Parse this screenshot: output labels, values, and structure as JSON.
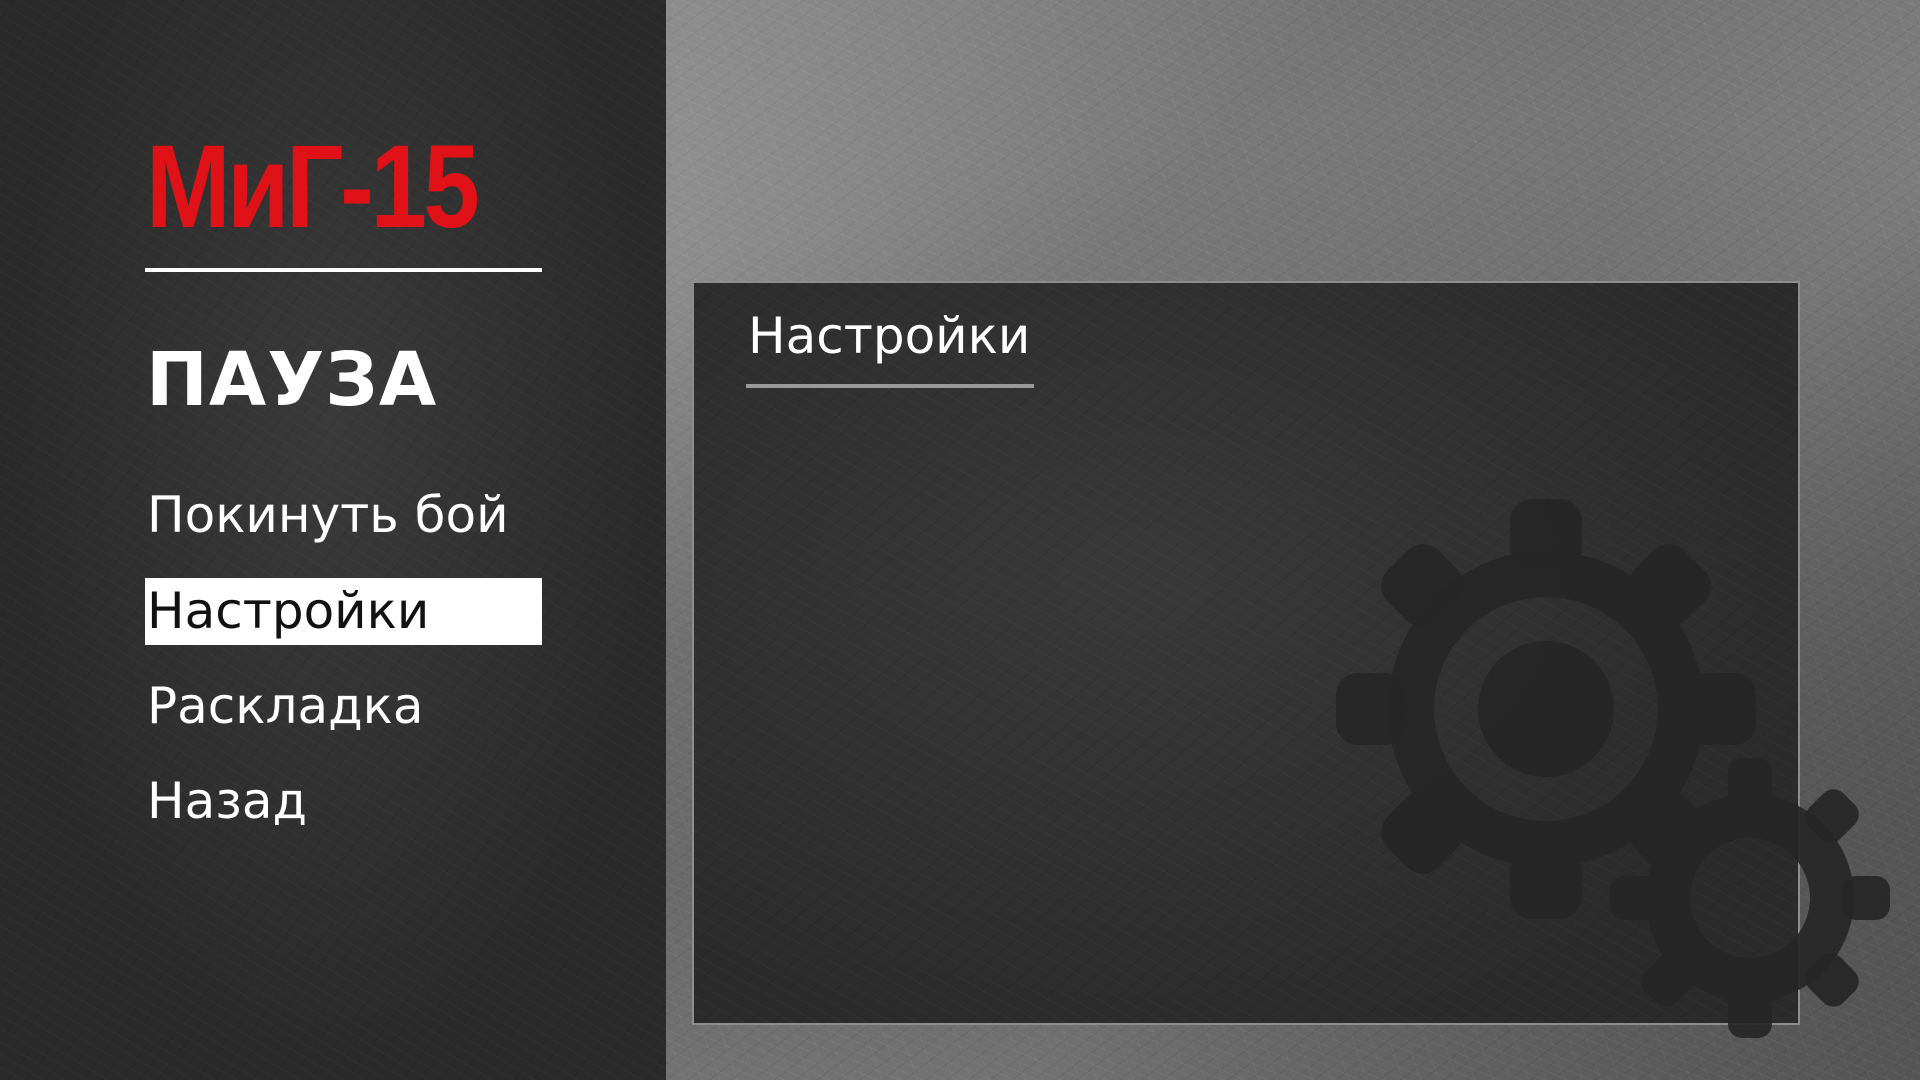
{
  "logo": {
    "text": "МиГ-15",
    "color": "#e01218"
  },
  "pause_title": "ПАУЗА",
  "menu": {
    "items": [
      {
        "label": "Покинуть бой",
        "selected": false
      },
      {
        "label": "Настройки",
        "selected": true
      },
      {
        "label": "Раскладка",
        "selected": false
      },
      {
        "label": "Назад",
        "selected": false
      }
    ]
  },
  "panel": {
    "title": "Настройки",
    "decoration_icon": "gears-icon"
  },
  "colors": {
    "accent_red": "#e01218",
    "selection_bg": "#ffffff",
    "panel_bg": "#333333",
    "sidebar_bg": "#2f2f2f"
  }
}
